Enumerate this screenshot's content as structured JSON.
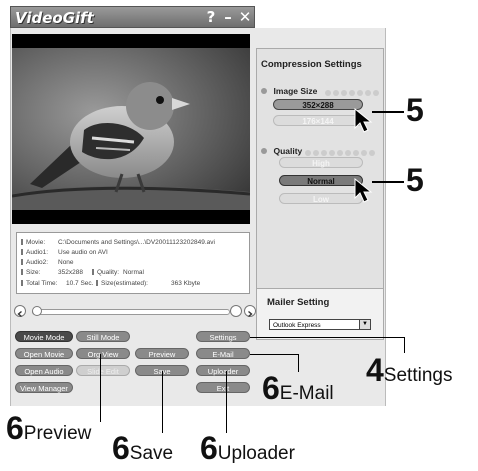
{
  "window": {
    "title": "VideoGift",
    "help_label": "?",
    "minimize_label": "–",
    "close_label": "✕"
  },
  "file_info": {
    "movie_label": "Movie:",
    "movie_value": "C:\\Documents and Settings\\...\\DV20011123202849.avi",
    "audio1_label": "Audio1:",
    "audio1_value": "Use audio on AVI",
    "audio2_label": "Audio2:",
    "audio2_value": "None",
    "size_label": "Size:",
    "size_value": "352x288",
    "quality_label": "Quality:",
    "quality_value": "Normal",
    "total_time_label": "Total Time:",
    "total_time_value": "10.7  Sec.",
    "size_est_label": "Size(estimated):",
    "size_est_value": "363  Kbyte"
  },
  "playback": {
    "position_fraction": 0.0
  },
  "buttons": {
    "movie_mode": "Movie Mode",
    "still_mode": "Still Mode",
    "settings": "Settings",
    "open_movie": "Open Movie",
    "org_view": "Org View",
    "preview": "Preview",
    "email": "E-Mail",
    "open_audio": "Open Audio",
    "slide_edit": "Slide Edit",
    "save": "Save",
    "uploader": "Uploader",
    "view_manager": "View Manager",
    "exit": "Exit"
  },
  "compression": {
    "title": "Compression Settings",
    "image_size_label": "Image Size",
    "size_options": [
      "352×288",
      "176×144"
    ],
    "selected_size": "352×288",
    "quality_label": "Quality",
    "quality_options": [
      "High",
      "Normal",
      "Low"
    ],
    "selected_quality": "Normal"
  },
  "mailer": {
    "title": "Mailer Setting",
    "selected": "Outlook Express",
    "arrow": "▼"
  },
  "annotations": {
    "size_num": "5",
    "quality_num": "5",
    "settings_num": "4",
    "settings_text": "Settings",
    "email_num": "6",
    "email_text": "E-Mail",
    "preview_num": "6",
    "preview_text": "Preview",
    "save_num": "6",
    "save_text": "Save",
    "uploader_num": "6",
    "uploader_text": "Uploader"
  },
  "colors": {
    "titlebar": "#7a7a7a",
    "button_dark": "#4a4a4a",
    "button_mid": "#8a8a8a",
    "panel_bg": "#e2e2e2"
  }
}
